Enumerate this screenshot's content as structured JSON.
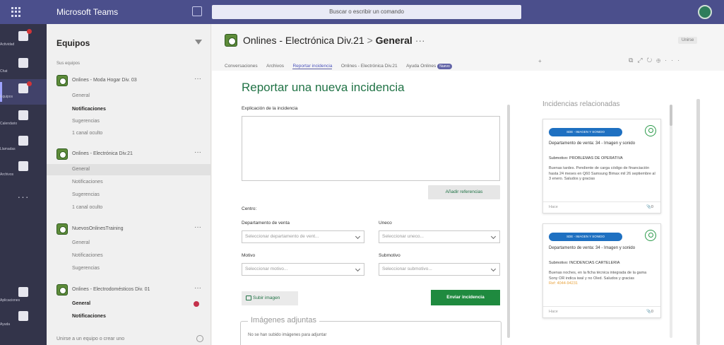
{
  "titlebar": {
    "app_name": "Microsoft Teams",
    "search_placeholder": "Buscar o escribir un comando"
  },
  "rail": [
    {
      "label": "Actividad",
      "icon": "bell-icon",
      "badge": true
    },
    {
      "label": "Chat",
      "icon": "chat-icon",
      "badge": false
    },
    {
      "label": "Equipos",
      "icon": "teams-icon",
      "badge": true
    },
    {
      "label": "Calendario",
      "icon": "calendar-icon",
      "badge": false
    },
    {
      "label": "Llamadas",
      "icon": "phone-icon",
      "badge": false
    },
    {
      "label": "Archivos",
      "icon": "files-icon",
      "badge": false
    },
    {
      "label": "Aplicaciones",
      "icon": "apps-icon",
      "badge": false
    },
    {
      "label": "Ayuda",
      "icon": "help-icon",
      "badge": false
    }
  ],
  "teams_panel": {
    "header": "Equipos",
    "section": "Sus equipos",
    "teams": [
      {
        "name": "Onlines - Moda Hogar Div. 03",
        "channels": [
          "General",
          "Notificaciones",
          "Sugerencias",
          "1 canal oculto"
        ]
      },
      {
        "name": "Onlines - Electrónica Div.21",
        "channels": [
          "General",
          "Notificaciones",
          "Sugerencias",
          "1 canal oculto"
        ]
      },
      {
        "name": "NuevosOnlinesTraining",
        "channels": [
          "General",
          "Notificaciones",
          "Sugerencias"
        ]
      },
      {
        "name": "Onlines - Electrodomésticos Div. 01",
        "channels": [
          "General",
          "Notificaciones"
        ]
      }
    ],
    "footer": "Unirse a un equipo o crear uno"
  },
  "header": {
    "team": "Onlines - Electrónica Div.21",
    "channel": "General",
    "more": "···",
    "join": "Unirse",
    "tabs": [
      "Conversaciones",
      "Archivos",
      "Reportar incidencia",
      "Onlines - Electrónica Div.21",
      "Ayuda Onlines"
    ],
    "new_badge": "Nuevo"
  },
  "form": {
    "title": "Reportar una nueva incidencia",
    "explanation_label": "Explicación de la incidencia",
    "add_refs": "Añadir referencias",
    "centro_label": "Centro:",
    "dept_label": "Departamento de venta",
    "dept_placeholder": "Seleccionar departamento de vent...",
    "uneco_label": "Uneco",
    "uneco_placeholder": "Seleccionar uneco...",
    "motivo_label": "Motivo",
    "motivo_placeholder": "Seleccionar motivo...",
    "submotivo_label": "Submotivo",
    "submotivo_placeholder": "Seleccionar submotivo...",
    "upload": "Subir imagen",
    "send": "Enviar incidencia",
    "images_legend": "Imágenes adjuntas",
    "images_empty": "No se han subido imágenes para adjuntar"
  },
  "related": {
    "title": "Incidencias relacionadas",
    "cards": [
      {
        "pill": "SDE - IMAGEN Y SONIDO",
        "dept": "Departamento de venta: 34 - Imagen y sonido",
        "sub": "Submotivo: PROBLEMAS DE OPERATIVA",
        "body": "Buenas tardes. Pendiente de carga código de financiación hasta 24 meses en Q60 Samsung Bimax mil 26 septiembre al 3 enero. Saludos y gracias",
        "time": "Hace",
        "attach": "0"
      },
      {
        "pill": "SDE - IMAGEN Y SONIDO",
        "dept": "Departamento de venta: 34 - Imagen y sonido",
        "sub": "Submotivo: INCIDENCIAS CARTELERÍA",
        "body": "Buenas noches, en la ficha técnica integrada de la gama Sony OR indica iwaI y no Oled. Saludos y gracias",
        "ref": "Ref: 4044-94231",
        "time": "Hace",
        "attach": "0"
      }
    ]
  }
}
